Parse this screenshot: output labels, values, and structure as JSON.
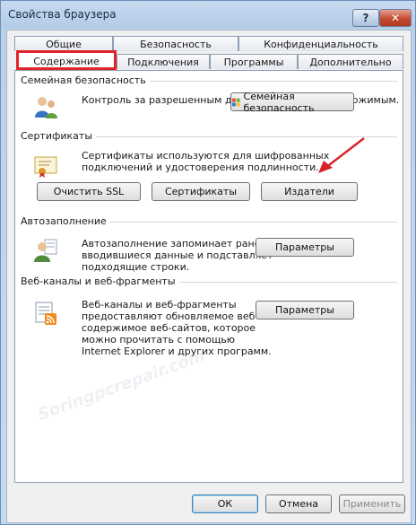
{
  "window": {
    "title": "Свойства браузера",
    "help_label": "?",
    "close_label": "✕"
  },
  "tabs": {
    "row1": [
      "Общие",
      "Безопасность",
      "Конфиденциальность"
    ],
    "row2": [
      "Содержание",
      "Подключения",
      "Программы",
      "Дополнительно"
    ],
    "active": "Содержание"
  },
  "family_safety": {
    "title": "Семейная безопасность",
    "description": "Контроль за разрешенным для просмотра веб-содержимым.",
    "button": "Семейная безопасность"
  },
  "certificates": {
    "title": "Сертификаты",
    "description_line1": "Сертификаты используются для шифрованных",
    "description_line2": "подключений и удостоверения подлинности.",
    "clear_ssl": "Очистить SSL",
    "certificates_button": "Сертификаты",
    "publishers_button": "Издатели"
  },
  "autocomplete": {
    "title": "Автозаполнение",
    "description_line1": "Автозаполнение запоминает ранее",
    "description_line2": "вводившиеся данные и подставляет",
    "description_line3": "подходящие строки.",
    "settings_button": "Параметры"
  },
  "feeds": {
    "title": "Веб-каналы и веб-фрагменты",
    "description_line1": "Веб-каналы и веб-фрагменты",
    "description_line2": "предоставляют обновляемое веб-",
    "description_line3": "содержимое веб-сайтов, которое",
    "description_line4": "можно прочитать с помощью",
    "description_line5": "Internet Explorer и других программ.",
    "settings_button": "Параметры"
  },
  "footer": {
    "ok": "ОК",
    "cancel": "Отмена",
    "apply": "Применить"
  },
  "watermark": "Soringpcrepair.com",
  "colors": {
    "highlight": "#e0242b",
    "arrow": "#d8232a"
  }
}
